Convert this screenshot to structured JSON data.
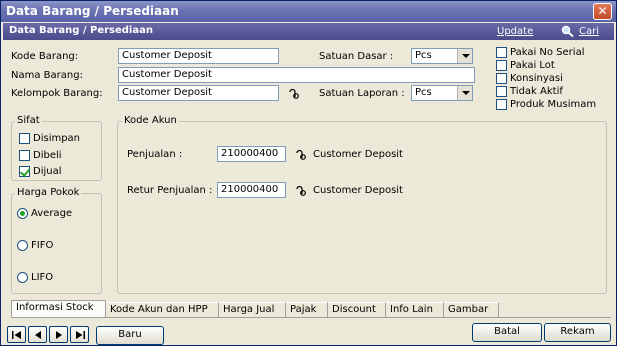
{
  "window": {
    "title": "Data Barang / Persediaan",
    "close_glyph": "✕"
  },
  "header": {
    "title": "Data Barang / Persediaan",
    "update_label": "Update",
    "search_label": "Cari",
    "search_icon": "search-icon"
  },
  "form": {
    "kode_barang": {
      "label": "Kode Barang:",
      "value": "Customer Deposit"
    },
    "nama_barang": {
      "label": "Nama Barang:",
      "value": "Customer Deposit"
    },
    "kelompok_barang": {
      "label": "Kelompok Barang:",
      "value": "Customer Deposit"
    },
    "satuan_dasar": {
      "label": "Satuan Dasar  :",
      "value": "Pcs"
    },
    "satuan_laporan": {
      "label": "Satuan Laporan  :",
      "value": "Pcs"
    }
  },
  "options": [
    {
      "label": "Pakai No Serial",
      "checked": false
    },
    {
      "label": "Pakai Lot",
      "checked": false
    },
    {
      "label": "Konsinyasi",
      "checked": false
    },
    {
      "label": "Tidak Aktif",
      "checked": false
    },
    {
      "label": "Produk Musimam",
      "checked": false
    }
  ],
  "sifat": {
    "title": "Sifat",
    "items": [
      {
        "label": "Disimpan",
        "checked": false
      },
      {
        "label": "Dibeli",
        "checked": false
      },
      {
        "label": "Dijual",
        "checked": true
      }
    ]
  },
  "harga_pokok": {
    "title": "Harga Pokok",
    "items": [
      {
        "label": "Average",
        "selected": true
      },
      {
        "label": "FIFO",
        "selected": false
      },
      {
        "label": "LIFO",
        "selected": false
      }
    ]
  },
  "kode_akun": {
    "title": "Kode Akun",
    "penjualan": {
      "label": "Penjualan :",
      "code": "210000400",
      "name": "Customer Deposit"
    },
    "retur": {
      "label": "Retur Penjualan :",
      "code": "210000400",
      "name": "Customer Deposit"
    }
  },
  "tabs": [
    {
      "label": "Informasi Stock",
      "active": true
    },
    {
      "label": "Kode Akun dan HPP",
      "active": false
    },
    {
      "label": "Harga Jual",
      "active": false
    },
    {
      "label": "Pajak",
      "active": false
    },
    {
      "label": "Discount",
      "active": false
    },
    {
      "label": "Info Lain",
      "active": false
    },
    {
      "label": "Gambar",
      "active": false
    }
  ],
  "footer": {
    "new_label": "Baru",
    "cancel_label": "Batal",
    "save_label": "Rekam"
  },
  "colors": {
    "title_bar": "#6a72b2",
    "header_bar": "#4b4b8c",
    "check": "#21a121"
  }
}
